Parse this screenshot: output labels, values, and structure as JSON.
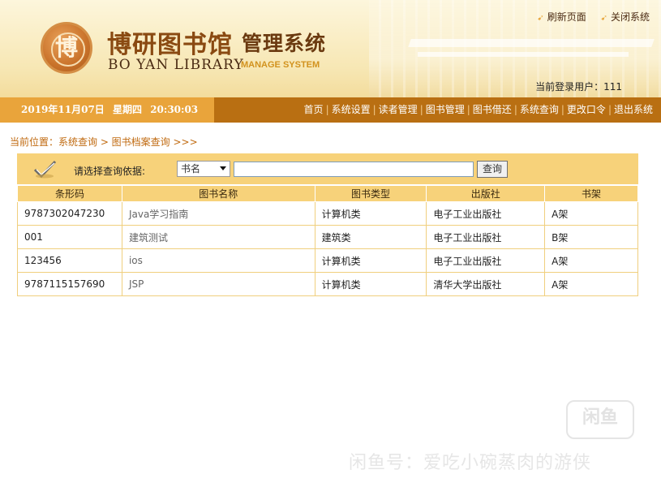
{
  "header": {
    "logo_glyph": "博",
    "title_cn": "博研图书馆",
    "title_cn2": "管理系统",
    "title_en": "BO YAN LIBRARY",
    "title_en2": "MANAGE SYSTEM",
    "top_links": [
      "刷新页面",
      "关闭系统"
    ],
    "login_user": "当前登录用户：111"
  },
  "navbar": {
    "date": "2019年11月07日",
    "weekday": "星期四",
    "time": "20:30:03",
    "menu": [
      "首页",
      "系统设置",
      "读者管理",
      "图书管理",
      "图书借还",
      "系统查询",
      "更改口令",
      "退出系统"
    ]
  },
  "breadcrumb": "当前位置：系统查询 > 图书档案查询 >>>",
  "search": {
    "label": "请选择查询依据:",
    "select_value": "书名",
    "input_value": "",
    "button_label": "查询"
  },
  "table": {
    "columns": [
      "条形码",
      "图书名称",
      "图书类型",
      "出版社",
      "书架"
    ],
    "rows": [
      [
        "9787302047230",
        "Java学习指南",
        "计算机类",
        "电子工业出版社",
        "A架"
      ],
      [
        "001",
        "建筑测试",
        "建筑类",
        "电子工业出版社",
        "B架"
      ],
      [
        "123456",
        "ios",
        "计算机类",
        "电子工业出版社",
        "A架"
      ],
      [
        "9787115157690",
        "JSP",
        "计算机类",
        "清华大学出版社",
        "A架"
      ]
    ]
  },
  "watermark": {
    "logo": "闲鱼",
    "text": "闲鱼号：爱吃小碗蒸肉的游侠"
  },
  "colors": {
    "nav_dark": "#b96f12",
    "nav_light": "#e9a43b",
    "table_header": "#f7d27a",
    "breadcrumb": "#c06a10"
  }
}
